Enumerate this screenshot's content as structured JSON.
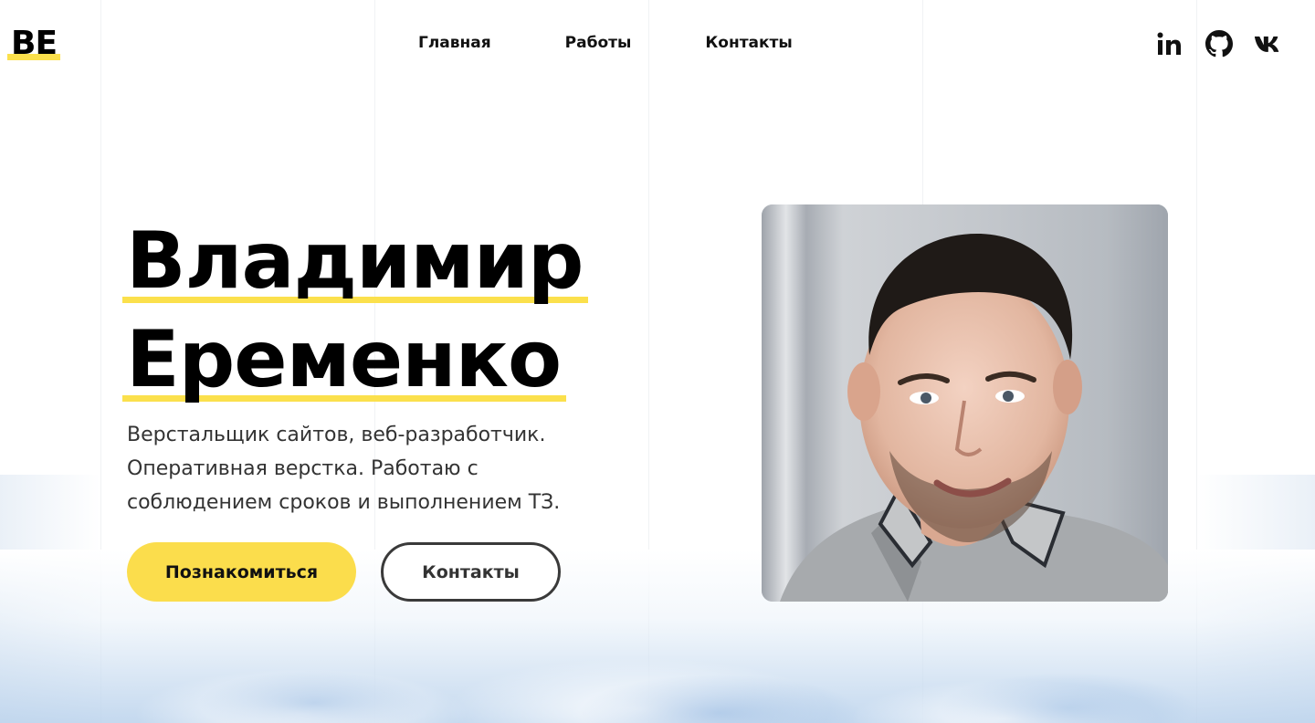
{
  "header": {
    "logo": "BE",
    "nav": [
      "Главная",
      "Работы",
      "Контакты"
    ],
    "socials": [
      {
        "icon": "linkedin-icon",
        "label": "in"
      },
      {
        "icon": "github-icon",
        "label": ""
      },
      {
        "icon": "vk-icon",
        "label": "vk"
      }
    ]
  },
  "hero": {
    "title_line1": "Владимир",
    "title_line2": "Еременко",
    "description": "Верстальщик сайтов, веб-разработчик. Оперативная верстка. Работаю с соблюдением сроков и выполнением ТЗ.",
    "primary_button": "Познакомиться",
    "secondary_button": "Контакты"
  },
  "colors": {
    "accent": "#fbdd4c",
    "text": "#111111",
    "outline": "#3a3a3a"
  }
}
